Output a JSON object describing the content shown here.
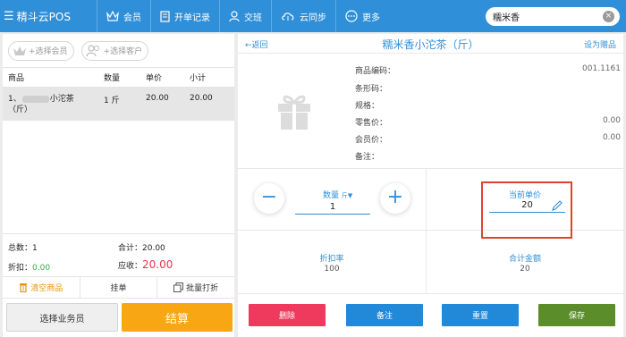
{
  "app": {
    "title": "精斗云POS"
  },
  "nav": [
    {
      "label": "会员",
      "icon": "crown-icon"
    },
    {
      "label": "开单记录",
      "icon": "receipt-icon"
    },
    {
      "label": "交班",
      "icon": "user-icon"
    },
    {
      "label": "云同步",
      "icon": "cloud-upload-icon"
    },
    {
      "label": "更多",
      "icon": "more-icon"
    }
  ],
  "search": {
    "value": "糯米香",
    "placeholder": ""
  },
  "left": {
    "select_member": "+选择会员",
    "select_customer": "+选择客户",
    "columns": [
      "商品",
      "数量",
      "单价",
      "小计"
    ],
    "rows": [
      {
        "index": "1、",
        "name": "小沱茶",
        "name2": "（斤）",
        "qty": "1 斤",
        "price": "20.00",
        "subtotal": "20.00"
      }
    ],
    "total_count_label": "总数：",
    "total_count": "1",
    "sum_label": "合计：",
    "sum": "20.00",
    "discount_label": "折扣：",
    "discount": "0.00",
    "receivable_label": "应收：",
    "receivable": "20.00",
    "actions": {
      "clear": "清空商品",
      "hold": "挂单",
      "batch_print": "批量打折"
    },
    "select_salesperson": "选择业务员",
    "checkout": "结算"
  },
  "product": {
    "back": "返回",
    "title": "糯米香小沱茶（斤）",
    "set_gift": "设为赠品",
    "info": [
      {
        "label": "商品编码：",
        "value": "001.1161"
      },
      {
        "label": "条形码：",
        "value": ""
      },
      {
        "label": "规格：",
        "value": ""
      },
      {
        "label": "零售价：",
        "value": "0.00"
      },
      {
        "label": "会员价：",
        "value": "0.00"
      },
      {
        "label": "备注：",
        "value": ""
      }
    ],
    "qty_label": "数量",
    "qty_unit": "斤",
    "qty_value": "1",
    "price_label": "当前单价",
    "price_value": "20",
    "discount_rate_label": "折扣率",
    "discount_rate": "100",
    "total_label": "合计金额",
    "total": "20"
  },
  "footer_buttons": {
    "delete": "删除",
    "note": "备注",
    "reset": "重置",
    "save": "保存"
  },
  "colors": {
    "brand": "#2f8fd8",
    "checkout": "#f8a614",
    "delete": "#ef3a5d",
    "note": "#2288d8",
    "reset": "#2288d8",
    "save": "#5b8e2b",
    "highlight": "#e0442a"
  }
}
